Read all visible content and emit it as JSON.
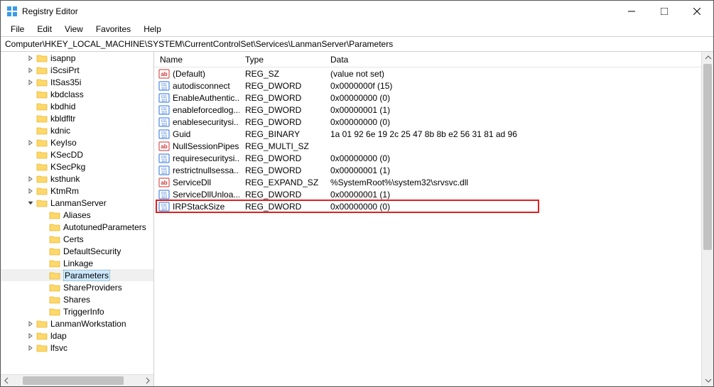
{
  "title": "Registry Editor",
  "menus": [
    "File",
    "Edit",
    "View",
    "Favorites",
    "Help"
  ],
  "address": "Computer\\HKEY_LOCAL_MACHINE\\SYSTEM\\CurrentControlSet\\Services\\LanmanServer\\Parameters",
  "columns": {
    "name": "Name",
    "type": "Type",
    "data": "Data"
  },
  "tree": [
    {
      "depth": 2,
      "twisty": "closed",
      "label": "isapnp"
    },
    {
      "depth": 2,
      "twisty": "closed",
      "label": "iScsiPrt"
    },
    {
      "depth": 2,
      "twisty": "closed",
      "label": "ItSas35i"
    },
    {
      "depth": 2,
      "twisty": "none",
      "label": "kbdclass"
    },
    {
      "depth": 2,
      "twisty": "none",
      "label": "kbdhid"
    },
    {
      "depth": 2,
      "twisty": "none",
      "label": "kbldfltr"
    },
    {
      "depth": 2,
      "twisty": "none",
      "label": "kdnic"
    },
    {
      "depth": 2,
      "twisty": "closed",
      "label": "KeyIso"
    },
    {
      "depth": 2,
      "twisty": "none",
      "label": "KSecDD"
    },
    {
      "depth": 2,
      "twisty": "none",
      "label": "KSecPkg"
    },
    {
      "depth": 2,
      "twisty": "closed",
      "label": "ksthunk"
    },
    {
      "depth": 2,
      "twisty": "closed",
      "label": "KtmRm"
    },
    {
      "depth": 2,
      "twisty": "open",
      "label": "LanmanServer"
    },
    {
      "depth": 3,
      "twisty": "none",
      "label": "Aliases"
    },
    {
      "depth": 3,
      "twisty": "none",
      "label": "AutotunedParameters"
    },
    {
      "depth": 3,
      "twisty": "none",
      "label": "Certs"
    },
    {
      "depth": 3,
      "twisty": "none",
      "label": "DefaultSecurity"
    },
    {
      "depth": 3,
      "twisty": "none",
      "label": "Linkage"
    },
    {
      "depth": 3,
      "twisty": "none",
      "label": "Parameters",
      "selected": true
    },
    {
      "depth": 3,
      "twisty": "none",
      "label": "ShareProviders"
    },
    {
      "depth": 3,
      "twisty": "none",
      "label": "Shares"
    },
    {
      "depth": 3,
      "twisty": "none",
      "label": "TriggerInfo"
    },
    {
      "depth": 2,
      "twisty": "closed",
      "label": "LanmanWorkstation"
    },
    {
      "depth": 2,
      "twisty": "closed",
      "label": "ldap"
    },
    {
      "depth": 2,
      "twisty": "closed",
      "label": "lfsvc"
    }
  ],
  "values": [
    {
      "icon": "str",
      "name": "(Default)",
      "type": "REG_SZ",
      "data": "(value not set)"
    },
    {
      "icon": "bin",
      "name": "autodisconnect",
      "type": "REG_DWORD",
      "data": "0x0000000f (15)"
    },
    {
      "icon": "bin",
      "name": "EnableAuthentic...",
      "type": "REG_DWORD",
      "data": "0x00000000 (0)"
    },
    {
      "icon": "bin",
      "name": "enableforcedlog...",
      "type": "REG_DWORD",
      "data": "0x00000001 (1)"
    },
    {
      "icon": "bin",
      "name": "enablesecuritysi...",
      "type": "REG_DWORD",
      "data": "0x00000000 (0)"
    },
    {
      "icon": "bin",
      "name": "Guid",
      "type": "REG_BINARY",
      "data": "1a 01 92 6e 19 2c 25 47 8b 8b e2 56 31 81 ad 96"
    },
    {
      "icon": "str",
      "name": "NullSessionPipes",
      "type": "REG_MULTI_SZ",
      "data": ""
    },
    {
      "icon": "bin",
      "name": "requiresecuritysi...",
      "type": "REG_DWORD",
      "data": "0x00000000 (0)"
    },
    {
      "icon": "bin",
      "name": "restrictnullsessa...",
      "type": "REG_DWORD",
      "data": "0x00000001 (1)"
    },
    {
      "icon": "str",
      "name": "ServiceDll",
      "type": "REG_EXPAND_SZ",
      "data": "%SystemRoot%\\system32\\srvsvc.dll"
    },
    {
      "icon": "bin",
      "name": "ServiceDllUnloa...",
      "type": "REG_DWORD",
      "data": "0x00000001 (1)"
    },
    {
      "icon": "bin",
      "name": "IRPStackSize",
      "type": "REG_DWORD",
      "data": "0x00000000 (0)",
      "highlight": true
    }
  ],
  "tree_scroll": {
    "thumb_left_pct": 8,
    "thumb_width_pct": 78
  },
  "list_vscroll": {
    "thumb_top_pct": 0,
    "thumb_height_pct": 60
  }
}
